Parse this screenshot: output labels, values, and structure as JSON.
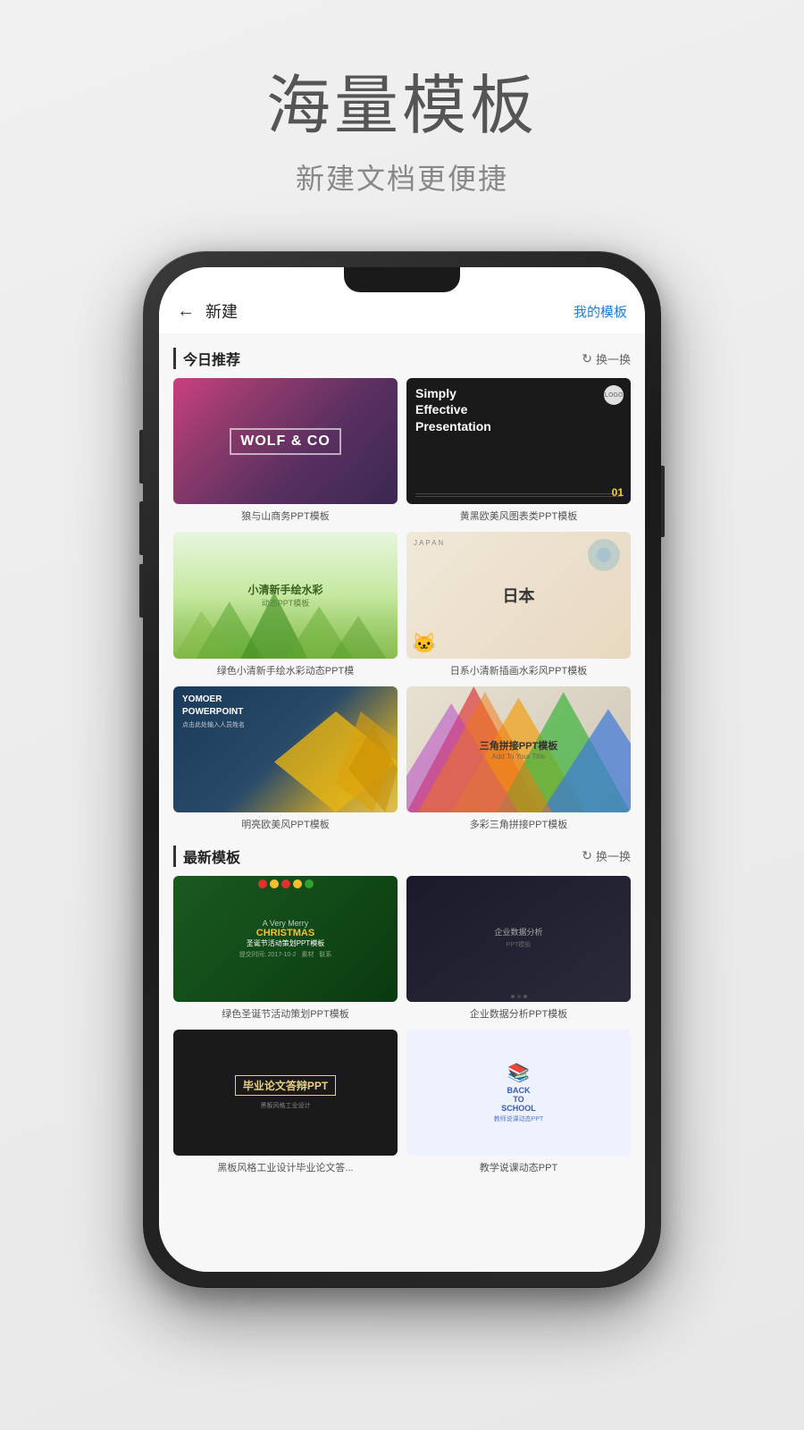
{
  "page": {
    "title": "海量模板",
    "subtitle": "新建文档更便捷"
  },
  "app": {
    "back_label": "←",
    "screen_title": "新建",
    "my_templates": "我的模板",
    "section_today": "今日推荐",
    "section_latest": "最新模板",
    "refresh_label": "换一换"
  },
  "today_templates": [
    {
      "id": "wolf",
      "name": "狼与山商务PPT模板"
    },
    {
      "id": "effective",
      "name": "黄黑欧美风图表类PPT模板"
    },
    {
      "id": "watercolor",
      "name": "绿色小清新手绘水彩动态PPT模"
    },
    {
      "id": "japan",
      "name": "日系小清新插画水彩风PPT模板"
    },
    {
      "id": "yomoer",
      "name": "明亮欧美风PPT模板"
    },
    {
      "id": "triangle",
      "name": "多彩三角拼接PPT模板"
    }
  ],
  "latest_templates": [
    {
      "id": "christmas",
      "name": "绿色圣诞节活动策划PPT模板"
    },
    {
      "id": "enterprise",
      "name": "企业数据分析PPT模板"
    },
    {
      "id": "graduation",
      "name": "黑板风格工业设计毕业论文答..."
    },
    {
      "id": "teacher",
      "name": "教学说课动态PPT"
    }
  ]
}
